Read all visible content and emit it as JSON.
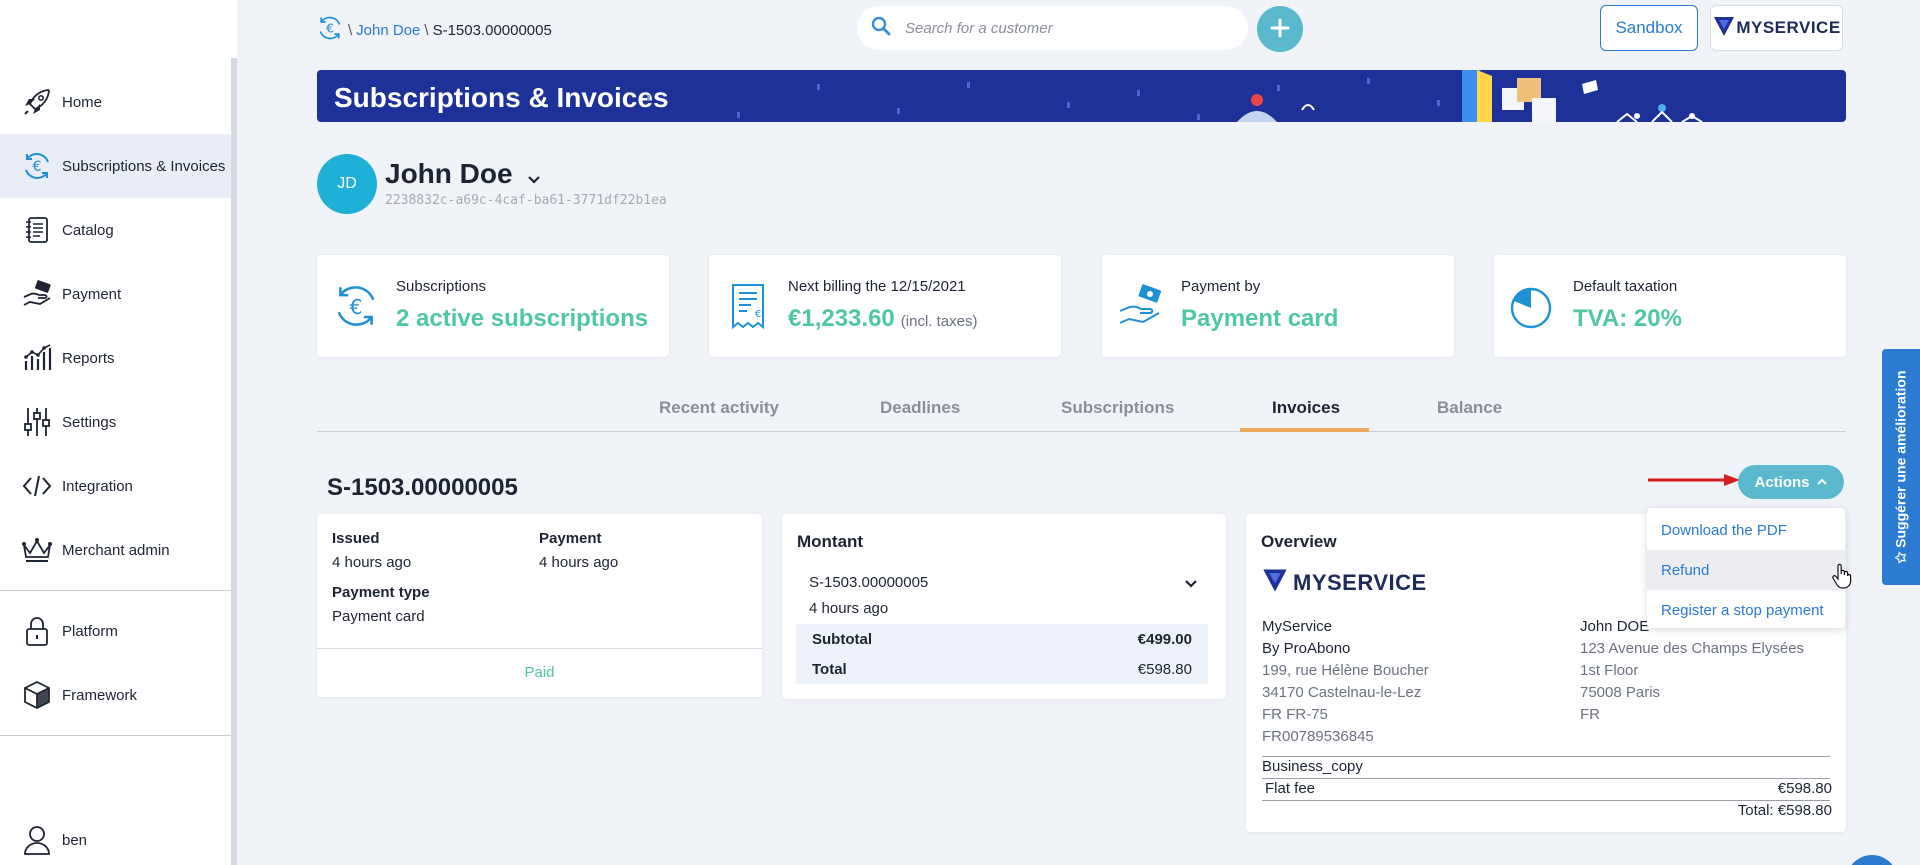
{
  "sidebar": {
    "items": [
      {
        "label": "Home",
        "icon": "rocket-icon"
      },
      {
        "label": "Subscriptions & Invoices",
        "icon": "euro-cycle-icon",
        "active": true
      },
      {
        "label": "Catalog",
        "icon": "notebook-icon"
      },
      {
        "label": "Payment",
        "icon": "hand-money-icon"
      },
      {
        "label": "Reports",
        "icon": "chart-icon"
      },
      {
        "label": "Settings",
        "icon": "sliders-icon"
      },
      {
        "label": "Integration",
        "icon": "code-icon"
      },
      {
        "label": "Merchant admin",
        "icon": "crown-icon"
      }
    ],
    "platform_items": [
      {
        "label": "Platform",
        "icon": "lock-icon"
      },
      {
        "label": "Framework",
        "icon": "cube-icon"
      }
    ],
    "user": {
      "label": "ben",
      "icon": "user-icon"
    }
  },
  "breadcrumb": {
    "customer": "John Doe",
    "current": "S-1503.00000005"
  },
  "search": {
    "placeholder": "Search for a customer"
  },
  "topbar": {
    "sandbox_label": "Sandbox",
    "brand_label": "MYSERVICE"
  },
  "banner": {
    "title": "Subscriptions & Invoices"
  },
  "customer": {
    "initials": "JD",
    "name": "John Doe",
    "id": "2238832c-a69c-4caf-ba61-3771df22b1ea"
  },
  "stats": [
    {
      "label": "Subscriptions",
      "value": "2 active subscriptions",
      "note": ""
    },
    {
      "label": "Next billing the 12/15/2021",
      "value": "€1,233.60",
      "note": "(incl. taxes)"
    },
    {
      "label": "Payment by",
      "value": "Payment card",
      "note": ""
    },
    {
      "label": "Default taxation",
      "value": "TVA: 20%",
      "note": ""
    }
  ],
  "tabs": [
    "Recent activity",
    "Deadlines",
    "Subscriptions",
    "Invoices",
    "Balance"
  ],
  "invoice": {
    "number": "S-1503.00000005",
    "actions_label": "Actions",
    "menu": [
      "Download the PDF",
      "Refund",
      "Register a stop payment"
    ],
    "status": {
      "issued_label": "Issued",
      "issued_value": "4 hours ago",
      "payment_label": "Payment",
      "payment_value": "4 hours ago",
      "type_label": "Payment type",
      "type_value": "Payment card",
      "state": "Paid"
    },
    "amount": {
      "title": "Montant",
      "item": "S-1503.00000005",
      "item_time": "4 hours ago",
      "subtotal_label": "Subtotal",
      "subtotal_value": "€499.00",
      "total_label": "Total",
      "total_value": "€598.80"
    },
    "overview": {
      "title": "Overview",
      "seller": [
        "MyService",
        "By ProAbono",
        "199, rue Hélène Boucher",
        "34170  Castelnau-le-Lez",
        "FR  FR-75",
        "FR00789536845"
      ],
      "buyer": [
        "John DOE",
        "123 Avenue des Champs Elysées",
        "1st Floor",
        "75008  Paris",
        "FR"
      ],
      "copy_label": "Business_copy",
      "line_label": "Flat fee",
      "line_value": "€598.80",
      "total": "Total: €598.80"
    }
  },
  "feedback": {
    "label": "Suggérer une amélioration"
  },
  "colors": {
    "accent": "#5ab9cf",
    "green": "#4fc7a7",
    "banner": "#1e3199",
    "link": "#2a7bd1",
    "tab_underline": "#f0a85a"
  }
}
